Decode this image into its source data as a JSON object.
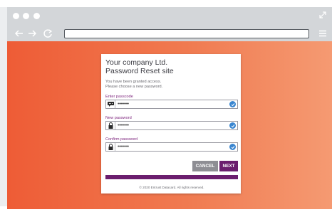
{
  "browser": {
    "icons": [
      "expand-icon",
      "back-icon",
      "forward-icon",
      "reload-icon",
      "menu-icon"
    ],
    "url": ""
  },
  "page": {
    "company_line1": "Your company Ltd.",
    "company_line2": "Password Reset site",
    "intro_line1": "You have been granted access.",
    "intro_line2": "Please choose a new password.",
    "fields": [
      {
        "label": "Enter passcode",
        "icon": "passcode-icon",
        "value": "••••••••",
        "valid": true
      },
      {
        "label": "New password",
        "icon": "lock-icon",
        "value": "••••••••",
        "valid": true
      },
      {
        "label": "Confirm password",
        "icon": "lock-icon",
        "value": "••••••••",
        "valid": true
      }
    ],
    "cancel_label": "CANCEL",
    "next_label": "NEXT",
    "copyright": "© 2020 Entrust Datacard. All rights reserved."
  },
  "colors": {
    "background_start": "#ee5c36",
    "background_end": "#f59a72",
    "accent": "#6b1e6e",
    "label": "#7a1f7a",
    "check": "#3a86d0",
    "cancel": "#8e8e94"
  }
}
